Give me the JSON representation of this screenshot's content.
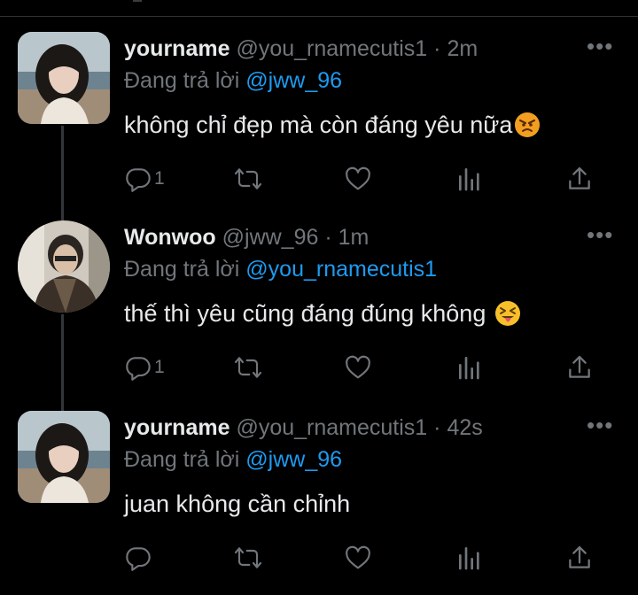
{
  "tweets": [
    {
      "display_name": "yourname",
      "handle": "@you_rnamecutis1",
      "time": "2m",
      "replying_prefix": "Đang trả lời",
      "replying_to": "@jww_96",
      "text": "không chỉ đẹp mà còn đáng yêu nữa",
      "emoji": "angry-face",
      "reply_count": "1"
    },
    {
      "display_name": "Wonwoo",
      "handle": "@jww_96",
      "time": "1m",
      "replying_prefix": "Đang trả lời",
      "replying_to": "@you_rnamecutis1",
      "text": "thế thì yêu cũng đáng đúng không",
      "emoji": "squinting-tongue-face",
      "reply_count": "1"
    },
    {
      "display_name": "yourname",
      "handle": "@you_rnamecutis1",
      "time": "42s",
      "replying_prefix": "Đang trả lời",
      "replying_to": "@jww_96",
      "text": "juan không cần chỉnh",
      "emoji": "",
      "reply_count": ""
    }
  ],
  "separator": "·",
  "more_glyph": "•••",
  "icons": {
    "reply": "reply-icon",
    "retweet": "retweet-icon",
    "like": "heart-icon",
    "views": "analytics-icon",
    "share": "share-icon",
    "more": "more-icon"
  },
  "colors": {
    "background": "#000000",
    "text": "#e7e9ea",
    "secondary": "#71767b",
    "link": "#1d9bf0",
    "thread_line": "#333639"
  }
}
